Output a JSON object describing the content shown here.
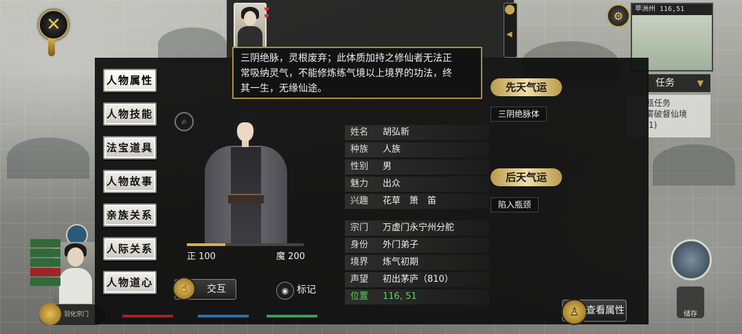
{
  "top_right": {
    "minimap_header": "苹洲州 116,51"
  },
  "quest": {
    "tab_label": "任务",
    "line1": "瓯任务",
    "line2": "雾破督仙境",
    "line3": "/1)"
  },
  "left_tabs": [
    {
      "label": "人物属性"
    },
    {
      "label": "人物技能"
    },
    {
      "label": "法宝道具"
    },
    {
      "label": "人物故事"
    },
    {
      "label": "亲族关系"
    },
    {
      "label": "人际关系"
    },
    {
      "label": "人物道心"
    }
  ],
  "tooltip": {
    "line1": "三阴绝脉，灵根废弃；此体质加持之修仙者无法正",
    "line2": "常吸纳灵气，不能修炼练气境以上境界的功法，终",
    "line3": "其一生，无缘仙途。"
  },
  "info": [
    {
      "key": "姓名",
      "value": "胡弘新"
    },
    {
      "key": "种族",
      "value": "人族"
    },
    {
      "key": "性别",
      "value": "男"
    },
    {
      "key": "魅力",
      "value": "出众"
    },
    {
      "key": "兴趣",
      "value": "花草　箫　笛"
    },
    {
      "key": "宗门",
      "value": "万虚门永宁州分舵"
    },
    {
      "key": "身份",
      "value": "外门弟子"
    },
    {
      "key": "境界",
      "value": "炼气初期"
    },
    {
      "key": "声望",
      "value": "初出茅庐（810）"
    },
    {
      "key": "位置",
      "value": "116, 51"
    }
  ],
  "innate_luck": {
    "title": "先天气运",
    "tags": [
      "三阴绝脉体"
    ]
  },
  "acquired_luck": {
    "title": "后天气运",
    "tags": [
      "陷入瓶颈"
    ]
  },
  "morality": {
    "good_label": "正 100",
    "evil_label": "魔 200",
    "good_fraction": 0.33
  },
  "actions": {
    "interact": "交互",
    "mark": "标记",
    "view_attributes": "查看属性"
  },
  "bottom_left": {
    "label": "羽化宗门"
  },
  "right_slot": {
    "label": "储存"
  },
  "colors": {
    "accent_gold": "#d9b04a",
    "position_green": "#5fd05f",
    "tooltip_border": "#b08d3e"
  }
}
